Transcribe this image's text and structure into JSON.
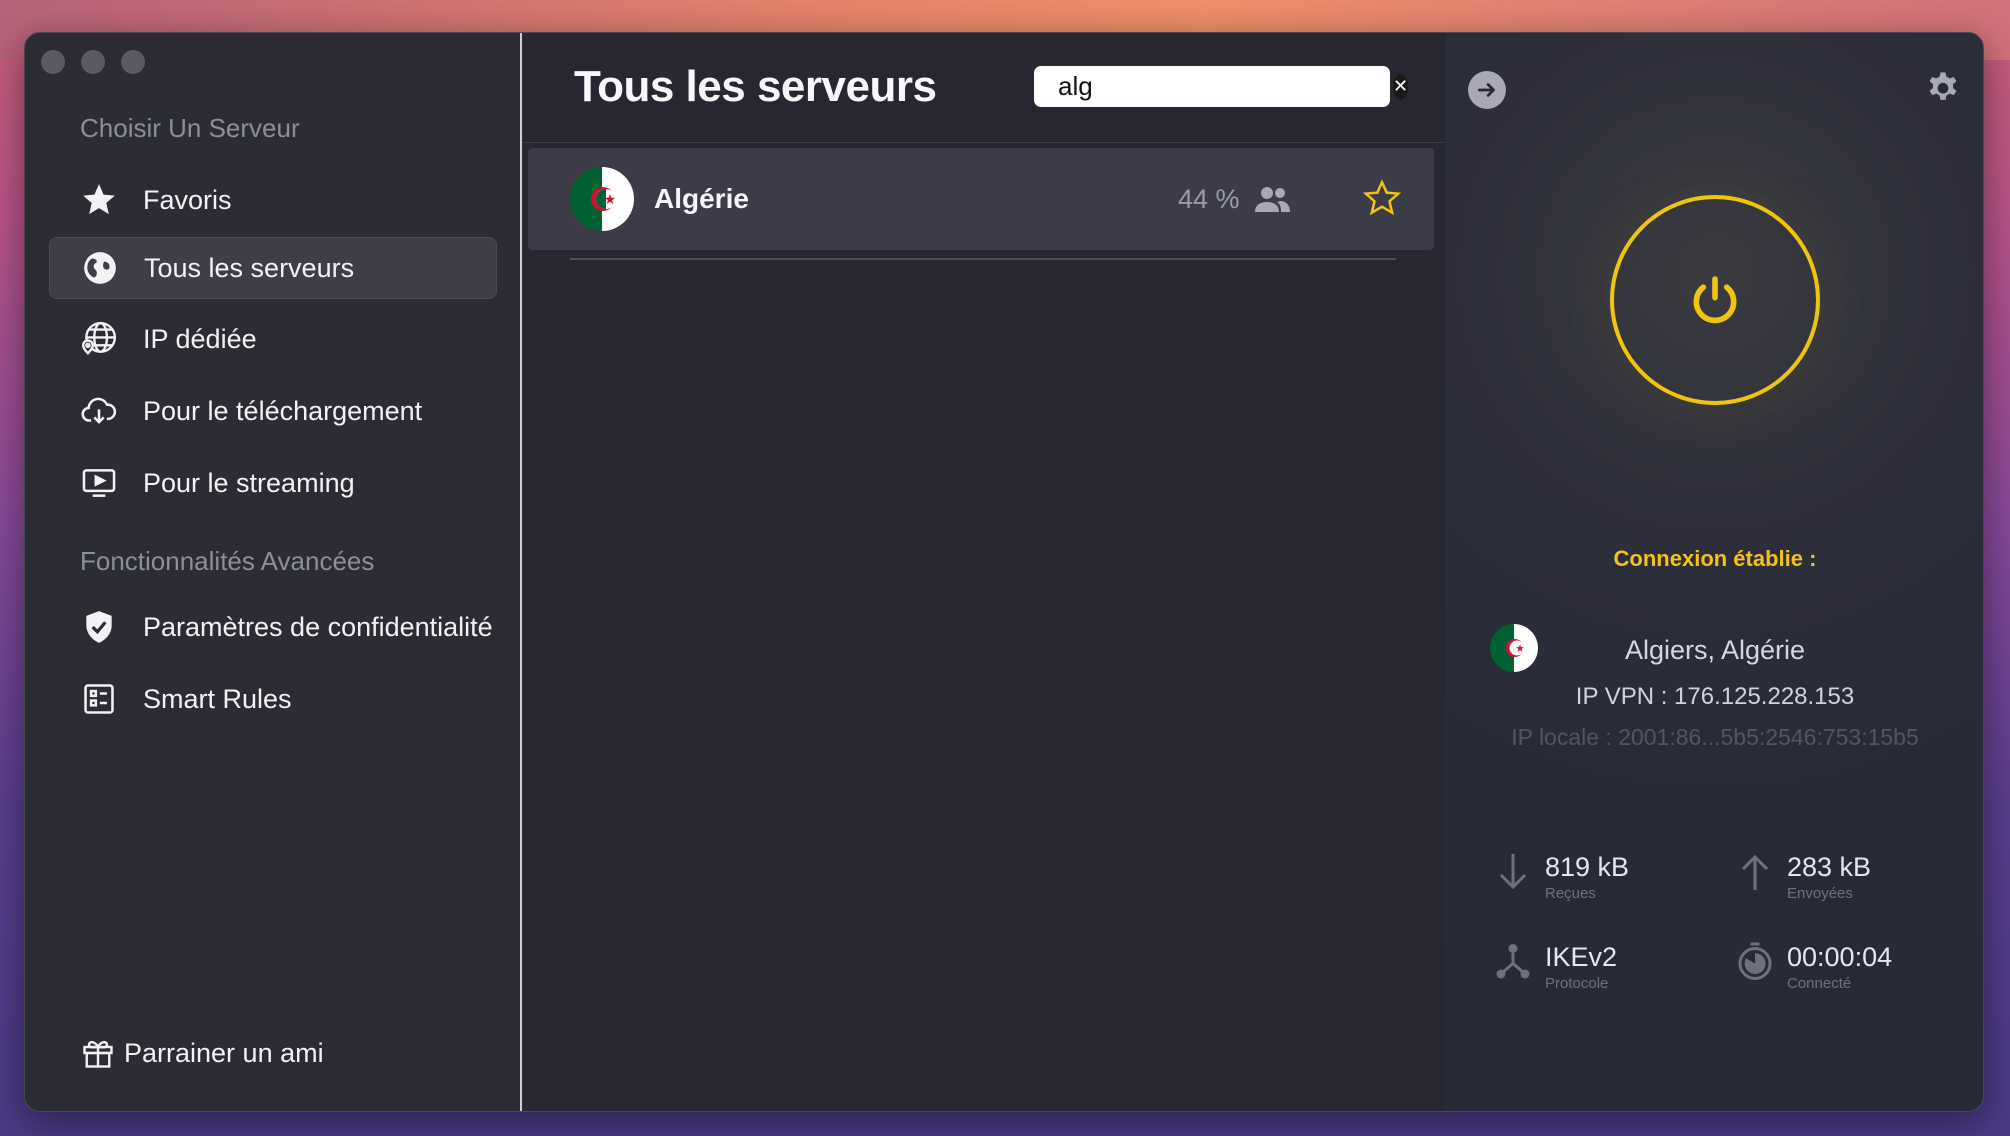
{
  "sidebar": {
    "section_choose": "Choisir Un Serveur",
    "items": [
      {
        "label": "Favoris",
        "icon": "star-icon"
      },
      {
        "label": "Tous les serveurs",
        "icon": "globe-icon",
        "active": true
      },
      {
        "label": "IP dédiée",
        "icon": "globe-pin-icon"
      },
      {
        "label": "Pour le téléchargement",
        "icon": "cloud-download-icon"
      },
      {
        "label": "Pour le streaming",
        "icon": "play-screen-icon"
      }
    ],
    "section_advanced": "Fonctionnalités Avancées",
    "advanced_items": [
      {
        "label": "Paramètres de confidentialité",
        "icon": "shield-check-icon"
      },
      {
        "label": "Smart Rules",
        "icon": "rules-icon"
      }
    ],
    "referral": "Parrainer un ami"
  },
  "main": {
    "title": "Tous les serveurs",
    "search": {
      "value": "alg",
      "placeholder": ""
    },
    "servers": [
      {
        "name": "Algérie",
        "load": "44 %",
        "favorite": false
      }
    ]
  },
  "connection": {
    "status": "Connexion établie :",
    "location": "Algiers, Algérie",
    "vpn_ip": "IP VPN : 176.125.228.153",
    "local_ip": "IP locale : 2001:86...5b5:2546:753:15b5",
    "stats": {
      "received": {
        "value": "819 kB",
        "label": "Reçues"
      },
      "sent": {
        "value": "283 kB",
        "label": "Envoyées"
      },
      "protocol": {
        "value": "IKEv2",
        "label": "Protocole"
      },
      "duration": {
        "value": "00:00:04",
        "label": "Connecté"
      }
    }
  },
  "colors": {
    "accent": "#f1c40f",
    "sidebar_bg": "#2b2c34",
    "main_bg": "#262731",
    "flag_green": "#006233",
    "flag_red": "#d21034"
  }
}
